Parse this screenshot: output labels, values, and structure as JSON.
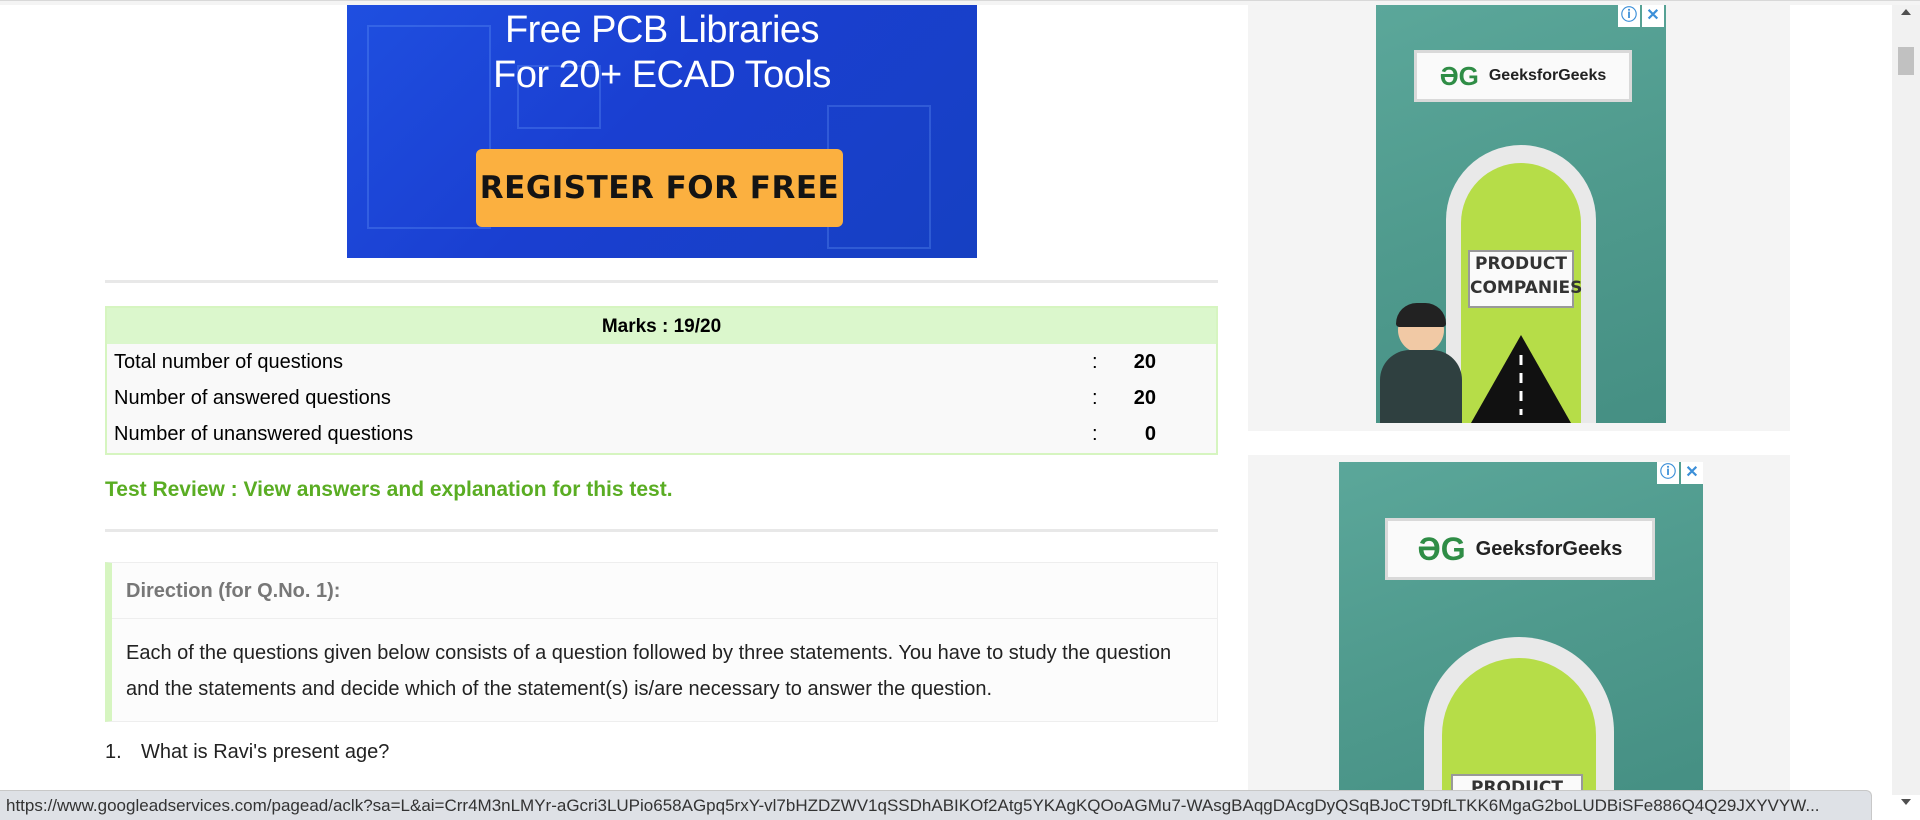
{
  "ad_banner": {
    "line1": "Free PCB Libraries",
    "line2": "For 20+ ECAD Tools",
    "cta": "REGISTER FOR FREE"
  },
  "marks": {
    "title": "Marks : 19/20",
    "rows": [
      {
        "label": "Total number of questions",
        "sep": ":",
        "value": "20"
      },
      {
        "label": "Number of answered questions",
        "sep": ":",
        "value": "20"
      },
      {
        "label": "Number of unanswered questions",
        "sep": ":",
        "value": "0"
      }
    ]
  },
  "review_link": "Test Review : View answers and explanation for this test.",
  "direction": {
    "heading": "Direction (for Q.No. 1):",
    "body": "Each of the questions given below consists of a question followed by three statements. You have to study the question and the statements and decide which of the statement(s) is/are necessary to answer the question."
  },
  "question": {
    "number": "1.",
    "text": "What is Ravi's present age?"
  },
  "side_ads": [
    {
      "brand": "GeeksforGeeks",
      "sign_line1": "PRODUCT",
      "sign_line2": "COMPANIES",
      "info_icon": "adchoices-info-icon",
      "close_icon": "close-icon"
    },
    {
      "brand": "GeeksforGeeks",
      "sign_line1": "PRODUCT",
      "info_icon": "adchoices-info-icon",
      "close_icon": "close-icon"
    }
  ],
  "status_bar": {
    "url": "https://www.googleadservices.com/pagead/aclk?sa=L&ai=Crr4M3nLMYr-aGcri3LUPio658AGpq5rxY-vl7bHZDZWV1qSSDhABIKOf2Atg5YKAgKQOoAGMu7-WAsgBAqgDAcgDyQSqBJoCT9DfLTKK6MgaG2boLUDBiSFe886Q4Q29JXYVYW..."
  },
  "colors": {
    "accent_green": "#5aad23",
    "table_header_bg": "#dbf7cc",
    "ad_blue": "#1f4fe0",
    "cta_orange": "#fbb040",
    "gfg_green": "#2f8d46"
  }
}
